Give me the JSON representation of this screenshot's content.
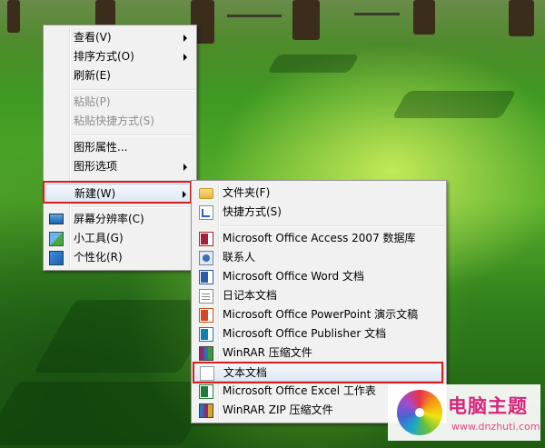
{
  "context_menu": {
    "items": [
      {
        "label": "查看(V)"
      },
      {
        "label": "排序方式(O)"
      },
      {
        "label": "刷新(E)"
      },
      {
        "label": "粘贴(P)"
      },
      {
        "label": "粘贴快捷方式(S)"
      },
      {
        "label": "图形属性..."
      },
      {
        "label": "图形选项"
      },
      {
        "label": "新建(W)"
      },
      {
        "label": "屏幕分辨率(C)",
        "icon": "screen-resolution-icon"
      },
      {
        "label": "小工具(G)",
        "icon": "gadgets-icon"
      },
      {
        "label": "个性化(R)",
        "icon": "personalize-icon"
      }
    ]
  },
  "new_submenu": {
    "items": [
      {
        "label": "文件夹(F)",
        "icon": "folder-icon"
      },
      {
        "label": "快捷方式(S)",
        "icon": "shortcut-icon"
      },
      {
        "label": "Microsoft Office Access 2007 数据库",
        "icon": "access-icon"
      },
      {
        "label": "联系人",
        "icon": "contact-icon"
      },
      {
        "label": "Microsoft Office Word 文档",
        "icon": "word-icon"
      },
      {
        "label": "日记本文档",
        "icon": "journal-icon"
      },
      {
        "label": "Microsoft Office PowerPoint 演示文稿",
        "icon": "powerpoint-icon"
      },
      {
        "label": "Microsoft Office Publisher 文档",
        "icon": "publisher-icon"
      },
      {
        "label": "WinRAR 压缩文件",
        "icon": "winrar-icon"
      },
      {
        "label": "文本文档",
        "icon": "text-document-icon"
      },
      {
        "label": "Microsoft Office Excel 工作表",
        "icon": "excel-icon"
      },
      {
        "label": "WinRAR ZIP 压缩文件",
        "icon": "winrar-zip-icon"
      }
    ]
  },
  "watermark": {
    "title": "电脑主题",
    "url": "www.dnzhuti.com"
  },
  "colors": {
    "highlight_box": "#d61e1e",
    "menu_background": "#f1f1f1"
  }
}
